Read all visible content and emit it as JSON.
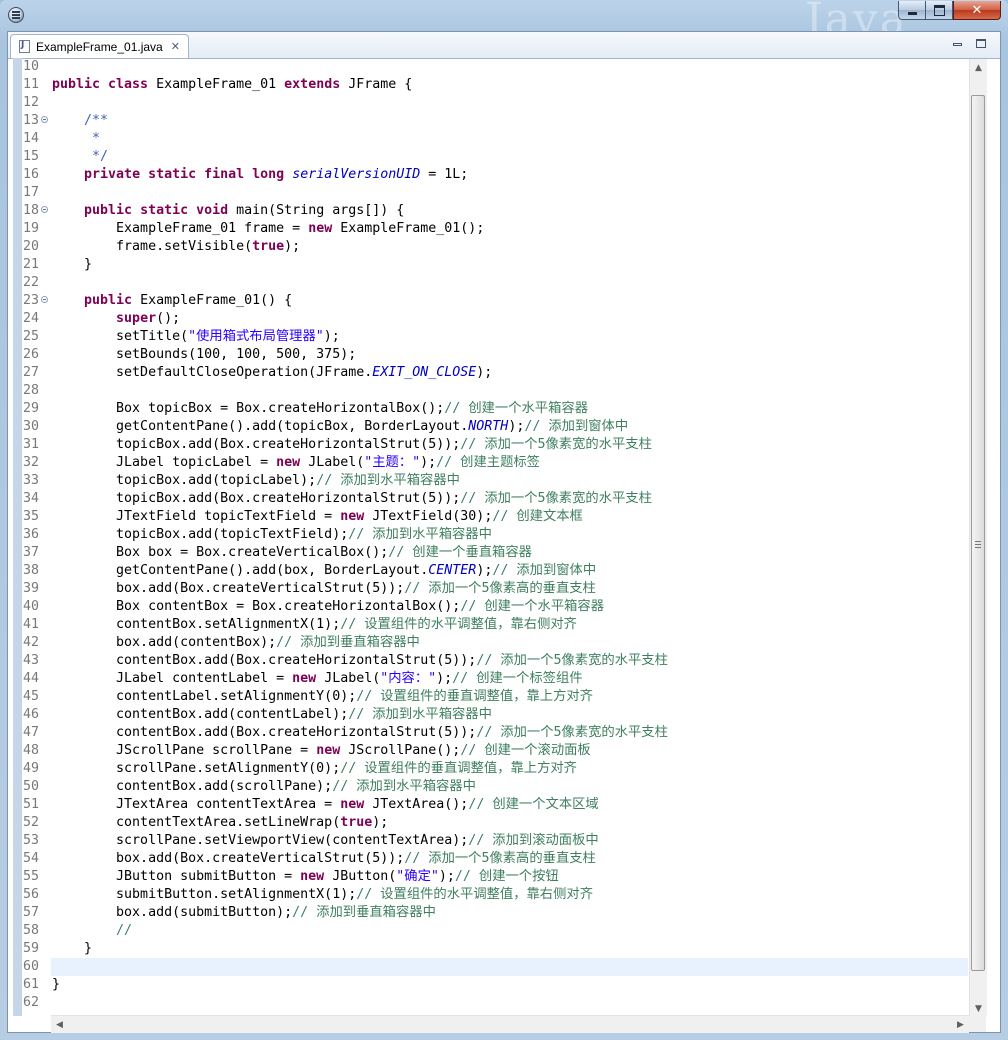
{
  "window": {
    "watermark": "Java",
    "min_label": "",
    "max_label": "",
    "close_label": "✕"
  },
  "editor": {
    "tab": {
      "label": "ExampleFrame_01.java",
      "close": "✕"
    },
    "current_line": 60,
    "lines": [
      {
        "n": 10,
        "segs": []
      },
      {
        "n": 11,
        "segs": [
          {
            "t": "public class",
            "c": "kw"
          },
          {
            "t": " ExampleFrame_01 ",
            "c": ""
          },
          {
            "t": "extends",
            "c": "kw"
          },
          {
            "t": " JFrame {",
            "c": ""
          }
        ]
      },
      {
        "n": 12,
        "segs": []
      },
      {
        "n": 13,
        "fold": true,
        "segs": [
          {
            "t": "    /**",
            "c": "jd"
          }
        ]
      },
      {
        "n": 14,
        "segs": [
          {
            "t": "     *",
            "c": "jd"
          }
        ]
      },
      {
        "n": 15,
        "segs": [
          {
            "t": "     */",
            "c": "jd"
          }
        ]
      },
      {
        "n": 16,
        "segs": [
          {
            "t": "    ",
            "c": ""
          },
          {
            "t": "private static final long",
            "c": "kw"
          },
          {
            "t": " ",
            "c": ""
          },
          {
            "t": "serialVersionUID",
            "c": "fd"
          },
          {
            "t": " = 1L;",
            "c": ""
          }
        ]
      },
      {
        "n": 17,
        "segs": []
      },
      {
        "n": 18,
        "fold": true,
        "segs": [
          {
            "t": "    ",
            "c": ""
          },
          {
            "t": "public static void",
            "c": "kw"
          },
          {
            "t": " main(String args[]) {",
            "c": ""
          }
        ]
      },
      {
        "n": 19,
        "segs": [
          {
            "t": "        ExampleFrame_01 frame = ",
            "c": ""
          },
          {
            "t": "new",
            "c": "kw"
          },
          {
            "t": " ExampleFrame_01();",
            "c": ""
          }
        ]
      },
      {
        "n": 20,
        "segs": [
          {
            "t": "        frame.setVisible(",
            "c": ""
          },
          {
            "t": "true",
            "c": "kw"
          },
          {
            "t": ");",
            "c": ""
          }
        ]
      },
      {
        "n": 21,
        "segs": [
          {
            "t": "    }",
            "c": ""
          }
        ]
      },
      {
        "n": 22,
        "segs": []
      },
      {
        "n": 23,
        "fold": true,
        "segs": [
          {
            "t": "    ",
            "c": ""
          },
          {
            "t": "public",
            "c": "kw"
          },
          {
            "t": " ExampleFrame_01() {",
            "c": ""
          }
        ]
      },
      {
        "n": 24,
        "segs": [
          {
            "t": "        ",
            "c": ""
          },
          {
            "t": "super",
            "c": "kw"
          },
          {
            "t": "();",
            "c": ""
          }
        ]
      },
      {
        "n": 25,
        "segs": [
          {
            "t": "        setTitle(",
            "c": ""
          },
          {
            "t": "\"使用箱式布局管理器\"",
            "c": "st"
          },
          {
            "t": ");",
            "c": ""
          }
        ]
      },
      {
        "n": 26,
        "segs": [
          {
            "t": "        setBounds(100, 100, 500, 375);",
            "c": ""
          }
        ]
      },
      {
        "n": 27,
        "segs": [
          {
            "t": "        setDefaultCloseOperation(JFrame.",
            "c": ""
          },
          {
            "t": "EXIT_ON_CLOSE",
            "c": "fd"
          },
          {
            "t": ");",
            "c": ""
          }
        ]
      },
      {
        "n": 28,
        "segs": []
      },
      {
        "n": 29,
        "segs": [
          {
            "t": "        Box topicBox = Box.",
            "c": ""
          },
          {
            "t": "createHorizontalBox",
            "c": ""
          },
          {
            "t": "();",
            "c": ""
          },
          {
            "t": "// 创建一个水平箱容器",
            "c": "cm"
          }
        ]
      },
      {
        "n": 30,
        "segs": [
          {
            "t": "        getContentPane().add(topicBox, BorderLayout.",
            "c": ""
          },
          {
            "t": "NORTH",
            "c": "fd"
          },
          {
            "t": ");",
            "c": ""
          },
          {
            "t": "// 添加到窗体中",
            "c": "cm"
          }
        ]
      },
      {
        "n": 31,
        "segs": [
          {
            "t": "        topicBox.add(Box.",
            "c": ""
          },
          {
            "t": "createHorizontalStrut",
            "c": ""
          },
          {
            "t": "(5));",
            "c": ""
          },
          {
            "t": "// 添加一个5像素宽的水平支柱",
            "c": "cm"
          }
        ]
      },
      {
        "n": 32,
        "segs": [
          {
            "t": "        JLabel topicLabel = ",
            "c": ""
          },
          {
            "t": "new",
            "c": "kw"
          },
          {
            "t": " JLabel(",
            "c": ""
          },
          {
            "t": "\"主题：\"",
            "c": "st"
          },
          {
            "t": ");",
            "c": ""
          },
          {
            "t": "// 创建主题标签",
            "c": "cm"
          }
        ]
      },
      {
        "n": 33,
        "segs": [
          {
            "t": "        topicBox.add(topicLabel);",
            "c": ""
          },
          {
            "t": "// 添加到水平箱容器中",
            "c": "cm"
          }
        ]
      },
      {
        "n": 34,
        "segs": [
          {
            "t": "        topicBox.add(Box.",
            "c": ""
          },
          {
            "t": "createHorizontalStrut",
            "c": ""
          },
          {
            "t": "(5));",
            "c": ""
          },
          {
            "t": "// 添加一个5像素宽的水平支柱",
            "c": "cm"
          }
        ]
      },
      {
        "n": 35,
        "segs": [
          {
            "t": "        JTextField topicTextField = ",
            "c": ""
          },
          {
            "t": "new",
            "c": "kw"
          },
          {
            "t": " JTextField(30);",
            "c": ""
          },
          {
            "t": "// 创建文本框",
            "c": "cm"
          }
        ]
      },
      {
        "n": 36,
        "segs": [
          {
            "t": "        topicBox.add(topicTextField);",
            "c": ""
          },
          {
            "t": "// 添加到水平箱容器中",
            "c": "cm"
          }
        ]
      },
      {
        "n": 37,
        "segs": [
          {
            "t": "        Box box = Box.",
            "c": ""
          },
          {
            "t": "createVerticalBox",
            "c": ""
          },
          {
            "t": "();",
            "c": ""
          },
          {
            "t": "// 创建一个垂直箱容器",
            "c": "cm"
          }
        ]
      },
      {
        "n": 38,
        "segs": [
          {
            "t": "        getContentPane().add(box, BorderLayout.",
            "c": ""
          },
          {
            "t": "CENTER",
            "c": "fd"
          },
          {
            "t": ");",
            "c": ""
          },
          {
            "t": "// 添加到窗体中",
            "c": "cm"
          }
        ]
      },
      {
        "n": 39,
        "segs": [
          {
            "t": "        box.add(Box.",
            "c": ""
          },
          {
            "t": "createVerticalStrut",
            "c": ""
          },
          {
            "t": "(5));",
            "c": ""
          },
          {
            "t": "// 添加一个5像素高的垂直支柱",
            "c": "cm"
          }
        ]
      },
      {
        "n": 40,
        "segs": [
          {
            "t": "        Box contentBox = Box.",
            "c": ""
          },
          {
            "t": "createHorizontalBox",
            "c": ""
          },
          {
            "t": "();",
            "c": ""
          },
          {
            "t": "// 创建一个水平箱容器",
            "c": "cm"
          }
        ]
      },
      {
        "n": 41,
        "segs": [
          {
            "t": "        contentBox.setAlignmentX(1);",
            "c": ""
          },
          {
            "t": "// 设置组件的水平调整值，靠右侧对齐",
            "c": "cm"
          }
        ]
      },
      {
        "n": 42,
        "segs": [
          {
            "t": "        box.add(contentBox);",
            "c": ""
          },
          {
            "t": "// 添加到垂直箱容器中",
            "c": "cm"
          }
        ]
      },
      {
        "n": 43,
        "segs": [
          {
            "t": "        contentBox.add(Box.",
            "c": ""
          },
          {
            "t": "createHorizontalStrut",
            "c": ""
          },
          {
            "t": "(5));",
            "c": ""
          },
          {
            "t": "// 添加一个5像素宽的水平支柱",
            "c": "cm"
          }
        ]
      },
      {
        "n": 44,
        "segs": [
          {
            "t": "        JLabel contentLabel = ",
            "c": ""
          },
          {
            "t": "new",
            "c": "kw"
          },
          {
            "t": " JLabel(",
            "c": ""
          },
          {
            "t": "\"内容：\"",
            "c": "st"
          },
          {
            "t": ");",
            "c": ""
          },
          {
            "t": "// 创建一个标签组件",
            "c": "cm"
          }
        ]
      },
      {
        "n": 45,
        "segs": [
          {
            "t": "        contentLabel.setAlignmentY(0);",
            "c": ""
          },
          {
            "t": "// 设置组件的垂直调整值，靠上方对齐",
            "c": "cm"
          }
        ]
      },
      {
        "n": 46,
        "segs": [
          {
            "t": "        contentBox.add(contentLabel);",
            "c": ""
          },
          {
            "t": "// 添加到水平箱容器中",
            "c": "cm"
          }
        ]
      },
      {
        "n": 47,
        "segs": [
          {
            "t": "        contentBox.add(Box.",
            "c": ""
          },
          {
            "t": "createHorizontalStrut",
            "c": ""
          },
          {
            "t": "(5));",
            "c": ""
          },
          {
            "t": "// 添加一个5像素宽的水平支柱",
            "c": "cm"
          }
        ]
      },
      {
        "n": 48,
        "segs": [
          {
            "t": "        JScrollPane scrollPane = ",
            "c": ""
          },
          {
            "t": "new",
            "c": "kw"
          },
          {
            "t": " JScrollPane();",
            "c": ""
          },
          {
            "t": "// 创建一个滚动面板",
            "c": "cm"
          }
        ]
      },
      {
        "n": 49,
        "segs": [
          {
            "t": "        scrollPane.setAlignmentY(0);",
            "c": ""
          },
          {
            "t": "// 设置组件的垂直调整值，靠上方对齐",
            "c": "cm"
          }
        ]
      },
      {
        "n": 50,
        "segs": [
          {
            "t": "        contentBox.add(scrollPane);",
            "c": ""
          },
          {
            "t": "// 添加到水平箱容器中",
            "c": "cm"
          }
        ]
      },
      {
        "n": 51,
        "segs": [
          {
            "t": "        JTextArea contentTextArea = ",
            "c": ""
          },
          {
            "t": "new",
            "c": "kw"
          },
          {
            "t": " JTextArea();",
            "c": ""
          },
          {
            "t": "// 创建一个文本区域",
            "c": "cm"
          }
        ]
      },
      {
        "n": 52,
        "segs": [
          {
            "t": "        contentTextArea.setLineWrap(",
            "c": ""
          },
          {
            "t": "true",
            "c": "kw"
          },
          {
            "t": ");",
            "c": ""
          }
        ]
      },
      {
        "n": 53,
        "segs": [
          {
            "t": "        scrollPane.setViewportView(contentTextArea);",
            "c": ""
          },
          {
            "t": "// 添加到滚动面板中",
            "c": "cm"
          }
        ]
      },
      {
        "n": 54,
        "segs": [
          {
            "t": "        box.add(Box.",
            "c": ""
          },
          {
            "t": "createVerticalStrut",
            "c": ""
          },
          {
            "t": "(5));",
            "c": ""
          },
          {
            "t": "// 添加一个5像素高的垂直支柱",
            "c": "cm"
          }
        ]
      },
      {
        "n": 55,
        "segs": [
          {
            "t": "        JButton submitButton = ",
            "c": ""
          },
          {
            "t": "new",
            "c": "kw"
          },
          {
            "t": " JButton(",
            "c": ""
          },
          {
            "t": "\"确定\"",
            "c": "st"
          },
          {
            "t": ");",
            "c": ""
          },
          {
            "t": "// 创建一个按钮",
            "c": "cm"
          }
        ]
      },
      {
        "n": 56,
        "segs": [
          {
            "t": "        submitButton.setAlignmentX(1);",
            "c": ""
          },
          {
            "t": "// 设置组件的水平调整值，靠右侧对齐",
            "c": "cm"
          }
        ]
      },
      {
        "n": 57,
        "segs": [
          {
            "t": "        box.add(submitButton);",
            "c": ""
          },
          {
            "t": "// 添加到垂直箱容器中",
            "c": "cm"
          }
        ]
      },
      {
        "n": 58,
        "segs": [
          {
            "t": "        //",
            "c": "cm"
          }
        ]
      },
      {
        "n": 59,
        "segs": [
          {
            "t": "    }",
            "c": ""
          }
        ]
      },
      {
        "n": 60,
        "segs": []
      },
      {
        "n": 61,
        "segs": [
          {
            "t": "}",
            "c": ""
          }
        ]
      },
      {
        "n": 62,
        "segs": []
      }
    ]
  },
  "scrollbars": {
    "vertical_up": "▲",
    "vertical_down": "▼",
    "horizontal_left": "◀",
    "horizontal_right": "▶"
  },
  "colors": {
    "keyword": "#7f0055",
    "comment": "#3f7f5f",
    "string": "#2a00ff",
    "javadoc": "#3f5fbf",
    "field": "#0000c0",
    "current_line_bg": "#e8f2fe"
  }
}
